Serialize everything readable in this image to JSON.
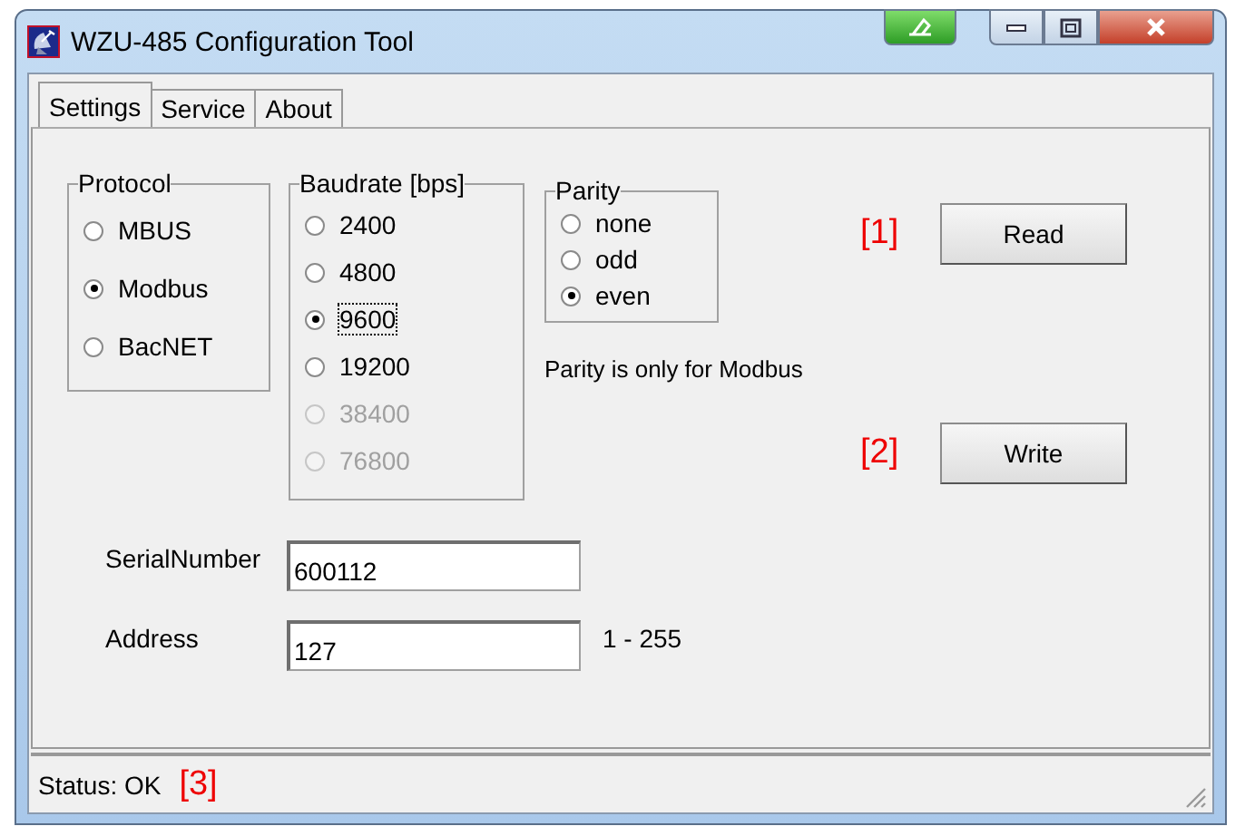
{
  "window": {
    "title": "WZU-485 Configuration Tool"
  },
  "tabs": [
    {
      "label": "Settings",
      "selected": true
    },
    {
      "label": "Service",
      "selected": false
    },
    {
      "label": "About",
      "selected": false
    }
  ],
  "protocol": {
    "title": "Protocol",
    "options": [
      {
        "label": "MBUS",
        "selected": false
      },
      {
        "label": "Modbus",
        "selected": true
      },
      {
        "label": "BacNET",
        "selected": false
      }
    ]
  },
  "baudrate": {
    "title": "Baudrate [bps]",
    "options": [
      {
        "label": "2400",
        "selected": false,
        "disabled": false,
        "focused": false
      },
      {
        "label": "4800",
        "selected": false,
        "disabled": false,
        "focused": false
      },
      {
        "label": "9600",
        "selected": true,
        "disabled": false,
        "focused": true
      },
      {
        "label": "19200",
        "selected": false,
        "disabled": false,
        "focused": false
      },
      {
        "label": "38400",
        "selected": false,
        "disabled": true,
        "focused": false
      },
      {
        "label": "76800",
        "selected": false,
        "disabled": true,
        "focused": false
      }
    ]
  },
  "parity": {
    "title": "Parity",
    "options": [
      {
        "label": "none",
        "selected": false
      },
      {
        "label": "odd",
        "selected": false
      },
      {
        "label": "even",
        "selected": true
      }
    ]
  },
  "parity_note": "Parity is only for Modbus",
  "buttons": [
    {
      "label": "Read",
      "marker": "[1]"
    },
    {
      "label": "Write",
      "marker": "[2]"
    }
  ],
  "fields": [
    {
      "label": "SerialNumber",
      "value": "600112"
    },
    {
      "label": "Address",
      "value": "127",
      "hint": "1 - 255"
    }
  ],
  "status_bar": {
    "text": "Status: OK",
    "marker": "[3]"
  }
}
